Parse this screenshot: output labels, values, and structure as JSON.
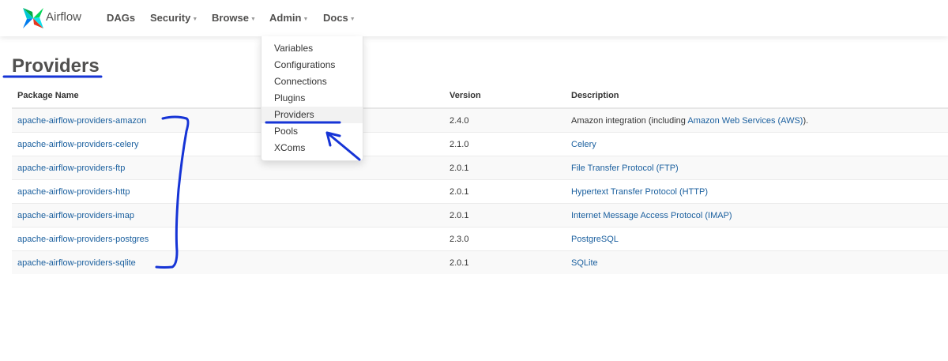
{
  "brand": {
    "name": "Airflow"
  },
  "nav": {
    "items": [
      {
        "label": "DAGs",
        "has_caret": false
      },
      {
        "label": "Security",
        "has_caret": true
      },
      {
        "label": "Browse",
        "has_caret": true
      },
      {
        "label": "Admin",
        "has_caret": true
      },
      {
        "label": "Docs",
        "has_caret": true
      }
    ]
  },
  "admin_menu": {
    "items": [
      "Variables",
      "Configurations",
      "Connections",
      "Plugins",
      "Providers",
      "Pools",
      "XComs"
    ],
    "active": "Providers"
  },
  "page": {
    "title": "Providers"
  },
  "table": {
    "headers": [
      "Package Name",
      "Version",
      "Description"
    ],
    "rows": [
      {
        "package": "apache-airflow-providers-amazon",
        "version": "2.4.0",
        "desc_pre": "Amazon integration (including ",
        "desc_link": "Amazon Web Services (AWS)",
        "desc_post": ")."
      },
      {
        "package": "apache-airflow-providers-celery",
        "version": "2.1.0",
        "desc_pre": "",
        "desc_link": "Celery",
        "desc_post": ""
      },
      {
        "package": "apache-airflow-providers-ftp",
        "version": "2.0.1",
        "desc_pre": "",
        "desc_link": "File Transfer Protocol (FTP)",
        "desc_post": ""
      },
      {
        "package": "apache-airflow-providers-http",
        "version": "2.0.1",
        "desc_pre": "",
        "desc_link": "Hypertext Transfer Protocol (HTTP)",
        "desc_post": ""
      },
      {
        "package": "apache-airflow-providers-imap",
        "version": "2.0.1",
        "desc_pre": "",
        "desc_link": "Internet Message Access Protocol (IMAP)",
        "desc_post": ""
      },
      {
        "package": "apache-airflow-providers-postgres",
        "version": "2.3.0",
        "desc_pre": "",
        "desc_link": "PostgreSQL",
        "desc_post": ""
      },
      {
        "package": "apache-airflow-providers-sqlite",
        "version": "2.0.1",
        "desc_pre": "",
        "desc_link": "SQLite",
        "desc_post": ""
      }
    ]
  },
  "colors": {
    "link": "#1a5f9e",
    "annotation": "#1634d6",
    "text": "#51504f"
  },
  "annotation_icons": [
    "underline-mark",
    "bracket-mark",
    "arrow-mark"
  ]
}
